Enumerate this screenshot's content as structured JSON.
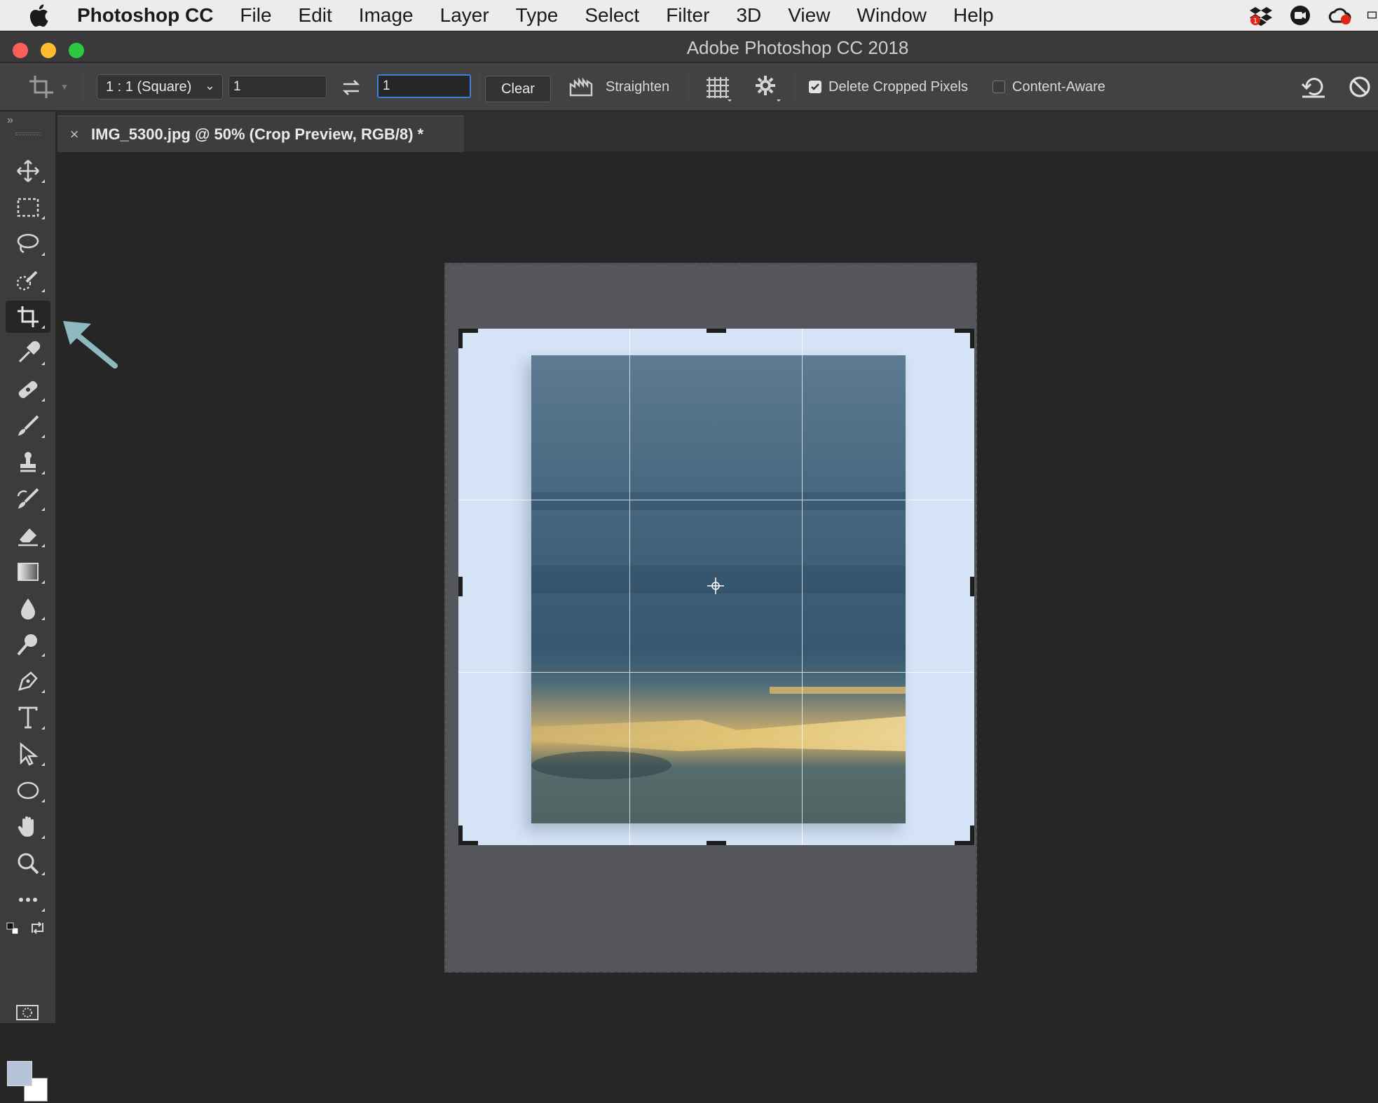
{
  "menubar": {
    "app_name": "Photoshop CC",
    "items": [
      "File",
      "Edit",
      "Image",
      "Layer",
      "Type",
      "Select",
      "Filter",
      "3D",
      "View",
      "Window",
      "Help"
    ]
  },
  "window": {
    "title": "Adobe Photoshop CC 2018"
  },
  "options": {
    "ratio_select": "1 : 1 (Square)",
    "width_value": "1",
    "height_value": "1",
    "clear_label": "Clear",
    "straighten_label": "Straighten",
    "delete_cropped_label": "Delete Cropped Pixels",
    "delete_cropped_checked": true,
    "content_aware_label": "Content-Aware",
    "content_aware_checked": false
  },
  "document": {
    "tab_title": "IMG_5300.jpg @ 50% (Crop Preview, RGB/8) *",
    "close_glyph": "×"
  },
  "tools": [
    {
      "name": "move-tool",
      "icon": "move-icon"
    },
    {
      "name": "marquee-tool",
      "icon": "rectangle-marquee-icon"
    },
    {
      "name": "lasso-tool",
      "icon": "lasso-icon"
    },
    {
      "name": "quick-selection-tool",
      "icon": "quick-selection-icon"
    },
    {
      "name": "crop-tool",
      "icon": "crop-icon",
      "active": true
    },
    {
      "name": "eyedropper-tool",
      "icon": "eyedropper-icon"
    },
    {
      "name": "healing-brush-tool",
      "icon": "bandage-icon"
    },
    {
      "name": "brush-tool",
      "icon": "brush-icon"
    },
    {
      "name": "clone-stamp-tool",
      "icon": "stamp-icon"
    },
    {
      "name": "history-brush-tool",
      "icon": "history-brush-icon"
    },
    {
      "name": "eraser-tool",
      "icon": "eraser-icon"
    },
    {
      "name": "gradient-tool",
      "icon": "gradient-icon"
    },
    {
      "name": "blur-tool",
      "icon": "drop-icon"
    },
    {
      "name": "dodge-tool",
      "icon": "dodge-icon"
    },
    {
      "name": "pen-tool",
      "icon": "pen-icon"
    },
    {
      "name": "type-tool",
      "icon": "type-icon"
    },
    {
      "name": "path-selection-tool",
      "icon": "arrow-cursor-icon"
    },
    {
      "name": "ellipse-tool",
      "icon": "ellipse-icon"
    },
    {
      "name": "hand-tool",
      "icon": "hand-icon"
    },
    {
      "name": "zoom-tool",
      "icon": "zoom-icon"
    },
    {
      "name": "more-tools",
      "icon": "ellipsis-icon"
    }
  ],
  "colors": {
    "foreground": "#b5c4d9",
    "background": "#ffffff",
    "annotation_arrow": "#8fb9c0"
  }
}
